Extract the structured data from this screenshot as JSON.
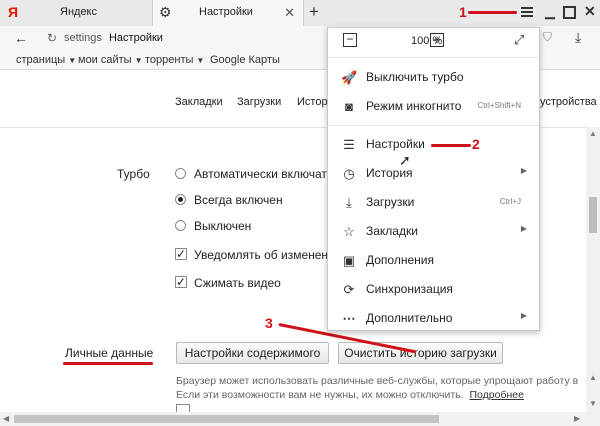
{
  "tabs": [
    {
      "label": "Яндекс",
      "logo": "Я"
    },
    {
      "label": "Настройки"
    }
  ],
  "address": {
    "prefix": "settings",
    "title": "Настройки"
  },
  "bookmarks": [
    "страницы",
    "мои сайты",
    "торренты",
    "Google Карты"
  ],
  "settings_nav": [
    "Закладки",
    "Загрузки",
    "Истор",
    "устройства"
  ],
  "turbo": {
    "section_label": "Турбо",
    "options": [
      "Автоматически включать",
      "Всегда включен",
      "Выключен"
    ],
    "selected_index": 1,
    "checkboxes": [
      "Уведомлять об изменени",
      "Сжимать видео"
    ]
  },
  "personal": {
    "section_label": "Личные данные",
    "content_settings_button": "Настройки содержимого",
    "clear_history_button": "Очистить историю загрузки",
    "description_line1": "Браузер может использовать различные веб-службы, которые упрощают работу в интерн",
    "description_line2": "Если эти возможности вам не нужны, их можно отключить.",
    "details_link": "Подробнее"
  },
  "menu": {
    "zoom_value": "100 %",
    "zoom_minus": "−",
    "zoom_plus": "+",
    "items": [
      {
        "label": "Выключить турбо",
        "icon": "rocket-icon",
        "shortcut": "",
        "submenu": false
      },
      {
        "label": "Режим инкогнито",
        "icon": "incognito-icon",
        "shortcut": "Ctrl+Shift+N",
        "submenu": false
      },
      {
        "label": "Настройки",
        "icon": "settings-sliders-icon",
        "shortcut": "",
        "submenu": false
      },
      {
        "label": "История",
        "icon": "clock-icon",
        "shortcut": "",
        "submenu": true
      },
      {
        "label": "Загрузки",
        "icon": "download-icon",
        "shortcut": "Ctrl+J",
        "submenu": false
      },
      {
        "label": "Закладки",
        "icon": "star-icon",
        "shortcut": "",
        "submenu": true
      },
      {
        "label": "Дополнения",
        "icon": "addons-icon",
        "shortcut": "",
        "submenu": false
      },
      {
        "label": "Синхронизация",
        "icon": "sync-icon",
        "shortcut": "",
        "submenu": false
      },
      {
        "label": "Дополнительно",
        "icon": "more-dots-icon",
        "shortcut": "",
        "submenu": true
      }
    ]
  },
  "annotations": {
    "step1": "1",
    "step2": "2",
    "step3": "3",
    "color": "#d0121a"
  }
}
